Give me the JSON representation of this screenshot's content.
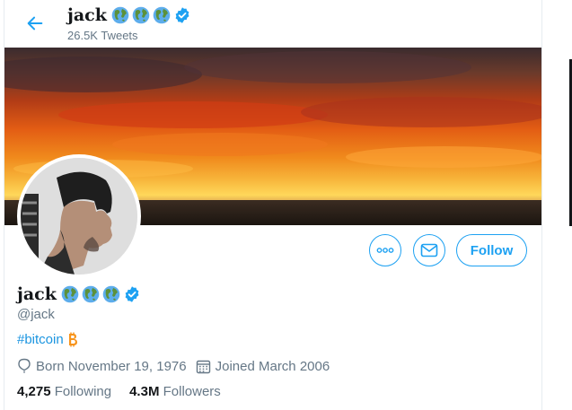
{
  "header": {
    "name": "jack",
    "tweets_count": "26.5K Tweets"
  },
  "profile": {
    "name": "jack",
    "handle": "@jack",
    "bio_hashtag": "#bitcoin",
    "born": "Born November 19, 1976",
    "joined": "Joined March 2006"
  },
  "stats": {
    "following_count": "4,275",
    "following_label": "Following",
    "followers_count": "4.3M",
    "followers_label": "Followers"
  },
  "actions": {
    "follow_label": "Follow"
  },
  "icons": {
    "back": "arrow-left-icon",
    "name_emoji": [
      "globe-americas-icon",
      "globe-europe-africa-icon",
      "globe-asia-australia-icon"
    ],
    "verified": "verified-badge-icon",
    "more": "more-horizontal-icon",
    "message": "envelope-icon",
    "bio_emoji": "bitcoin-icon",
    "born": "balloon-icon",
    "joined": "calendar-icon"
  },
  "colors": {
    "accent": "#1da1f2",
    "link": "#1b95e0",
    "secondary_text": "#657786",
    "primary_text": "#14171a",
    "bitcoin": "#f7931a"
  }
}
